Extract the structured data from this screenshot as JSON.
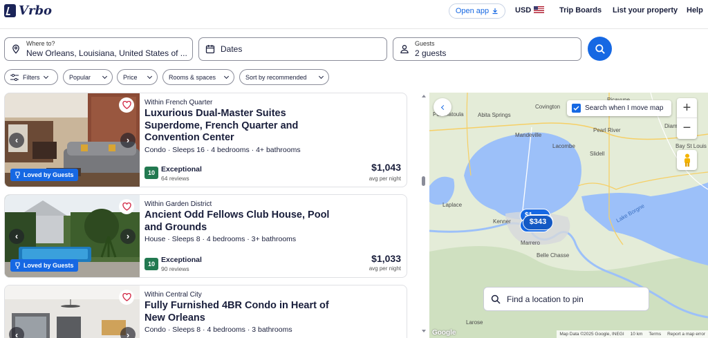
{
  "header": {
    "brand": "Vrbo",
    "open_app": "Open app",
    "currency": "USD",
    "nav": [
      "Trip Boards",
      "List your property",
      "Help"
    ]
  },
  "search": {
    "where_label": "Where to?",
    "where_value": "New Orleans, Louisiana, United States of ...",
    "dates_label": "Dates",
    "guests_label": "Guests",
    "guests_value": "2 guests"
  },
  "filters": [
    "Filters",
    "Popular",
    "Price",
    "Rooms & spaces",
    "Sort by recommended"
  ],
  "listings": [
    {
      "location": "Within French Quarter",
      "title": "Luxurious Dual-Master Suites Superdome, French Quarter and Convention Center",
      "meta": "Condo · Sleeps 16 · 4 bedrooms · 4+ bathrooms",
      "badge": "Loved by Guests",
      "score": "10",
      "rating_word": "Exceptional",
      "reviews": "64 reviews",
      "price": "$1,043",
      "price_note": "avg per night"
    },
    {
      "location": "Within Garden District",
      "title": "Ancient Odd Fellows Club House, Pool and Grounds",
      "meta": "House · Sleeps 8 · 4 bedrooms · 3+ bathrooms",
      "badge": "Loved by Guests",
      "score": "10",
      "rating_word": "Exceptional",
      "reviews": "90 reviews",
      "price": "$1,033",
      "price_note": "avg per night"
    },
    {
      "location": "Within Central City",
      "title": "Fully Furnished 4BR Condo in Heart of New Orleans",
      "meta": "Condo · Sleeps 8 · 4 bedrooms · 3 bathrooms"
    }
  ],
  "map": {
    "search_when_move": "Search when I move map",
    "search_when_move_checked": true,
    "find_location": "Find a location to pin",
    "cluster_price": "$343",
    "cluster_partial": "$1",
    "attribution": "Map Data ©2025 Google, INEGI",
    "scale": "10 km",
    "terms": "Terms",
    "report": "Report a map error",
    "google": "Google",
    "places": [
      "Covington",
      "Mandeville",
      "Lacombe",
      "Slidell",
      "Pearl River",
      "Picayune",
      "Diamond",
      "Bay St Louis",
      "Ponchatoula",
      "Abita Springs",
      "Laplace",
      "Kenner",
      "Marrero",
      "Belle Chasse",
      "Lake Borgne",
      "Larose"
    ],
    "colors": {
      "water": "#9cc0f9",
      "land": "#e4ecd8",
      "pin": "#1668e3"
    }
  }
}
